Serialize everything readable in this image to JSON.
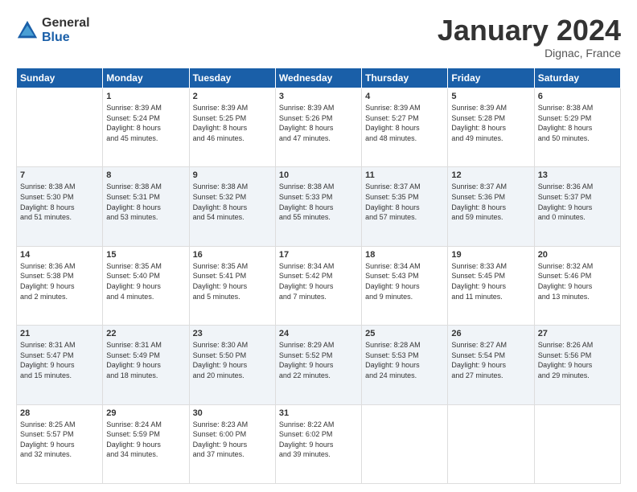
{
  "logo": {
    "general": "General",
    "blue": "Blue"
  },
  "title": "January 2024",
  "location": "Dignac, France",
  "days_header": [
    "Sunday",
    "Monday",
    "Tuesday",
    "Wednesday",
    "Thursday",
    "Friday",
    "Saturday"
  ],
  "weeks": [
    [
      {
        "num": "",
        "text": ""
      },
      {
        "num": "1",
        "text": "Sunrise: 8:39 AM\nSunset: 5:24 PM\nDaylight: 8 hours\nand 45 minutes."
      },
      {
        "num": "2",
        "text": "Sunrise: 8:39 AM\nSunset: 5:25 PM\nDaylight: 8 hours\nand 46 minutes."
      },
      {
        "num": "3",
        "text": "Sunrise: 8:39 AM\nSunset: 5:26 PM\nDaylight: 8 hours\nand 47 minutes."
      },
      {
        "num": "4",
        "text": "Sunrise: 8:39 AM\nSunset: 5:27 PM\nDaylight: 8 hours\nand 48 minutes."
      },
      {
        "num": "5",
        "text": "Sunrise: 8:39 AM\nSunset: 5:28 PM\nDaylight: 8 hours\nand 49 minutes."
      },
      {
        "num": "6",
        "text": "Sunrise: 8:38 AM\nSunset: 5:29 PM\nDaylight: 8 hours\nand 50 minutes."
      }
    ],
    [
      {
        "num": "7",
        "text": "Sunrise: 8:38 AM\nSunset: 5:30 PM\nDaylight: 8 hours\nand 51 minutes."
      },
      {
        "num": "8",
        "text": "Sunrise: 8:38 AM\nSunset: 5:31 PM\nDaylight: 8 hours\nand 53 minutes."
      },
      {
        "num": "9",
        "text": "Sunrise: 8:38 AM\nSunset: 5:32 PM\nDaylight: 8 hours\nand 54 minutes."
      },
      {
        "num": "10",
        "text": "Sunrise: 8:38 AM\nSunset: 5:33 PM\nDaylight: 8 hours\nand 55 minutes."
      },
      {
        "num": "11",
        "text": "Sunrise: 8:37 AM\nSunset: 5:35 PM\nDaylight: 8 hours\nand 57 minutes."
      },
      {
        "num": "12",
        "text": "Sunrise: 8:37 AM\nSunset: 5:36 PM\nDaylight: 8 hours\nand 59 minutes."
      },
      {
        "num": "13",
        "text": "Sunrise: 8:36 AM\nSunset: 5:37 PM\nDaylight: 9 hours\nand 0 minutes."
      }
    ],
    [
      {
        "num": "14",
        "text": "Sunrise: 8:36 AM\nSunset: 5:38 PM\nDaylight: 9 hours\nand 2 minutes."
      },
      {
        "num": "15",
        "text": "Sunrise: 8:35 AM\nSunset: 5:40 PM\nDaylight: 9 hours\nand 4 minutes."
      },
      {
        "num": "16",
        "text": "Sunrise: 8:35 AM\nSunset: 5:41 PM\nDaylight: 9 hours\nand 5 minutes."
      },
      {
        "num": "17",
        "text": "Sunrise: 8:34 AM\nSunset: 5:42 PM\nDaylight: 9 hours\nand 7 minutes."
      },
      {
        "num": "18",
        "text": "Sunrise: 8:34 AM\nSunset: 5:43 PM\nDaylight: 9 hours\nand 9 minutes."
      },
      {
        "num": "19",
        "text": "Sunrise: 8:33 AM\nSunset: 5:45 PM\nDaylight: 9 hours\nand 11 minutes."
      },
      {
        "num": "20",
        "text": "Sunrise: 8:32 AM\nSunset: 5:46 PM\nDaylight: 9 hours\nand 13 minutes."
      }
    ],
    [
      {
        "num": "21",
        "text": "Sunrise: 8:31 AM\nSunset: 5:47 PM\nDaylight: 9 hours\nand 15 minutes."
      },
      {
        "num": "22",
        "text": "Sunrise: 8:31 AM\nSunset: 5:49 PM\nDaylight: 9 hours\nand 18 minutes."
      },
      {
        "num": "23",
        "text": "Sunrise: 8:30 AM\nSunset: 5:50 PM\nDaylight: 9 hours\nand 20 minutes."
      },
      {
        "num": "24",
        "text": "Sunrise: 8:29 AM\nSunset: 5:52 PM\nDaylight: 9 hours\nand 22 minutes."
      },
      {
        "num": "25",
        "text": "Sunrise: 8:28 AM\nSunset: 5:53 PM\nDaylight: 9 hours\nand 24 minutes."
      },
      {
        "num": "26",
        "text": "Sunrise: 8:27 AM\nSunset: 5:54 PM\nDaylight: 9 hours\nand 27 minutes."
      },
      {
        "num": "27",
        "text": "Sunrise: 8:26 AM\nSunset: 5:56 PM\nDaylight: 9 hours\nand 29 minutes."
      }
    ],
    [
      {
        "num": "28",
        "text": "Sunrise: 8:25 AM\nSunset: 5:57 PM\nDaylight: 9 hours\nand 32 minutes."
      },
      {
        "num": "29",
        "text": "Sunrise: 8:24 AM\nSunset: 5:59 PM\nDaylight: 9 hours\nand 34 minutes."
      },
      {
        "num": "30",
        "text": "Sunrise: 8:23 AM\nSunset: 6:00 PM\nDaylight: 9 hours\nand 37 minutes."
      },
      {
        "num": "31",
        "text": "Sunrise: 8:22 AM\nSunset: 6:02 PM\nDaylight: 9 hours\nand 39 minutes."
      },
      {
        "num": "",
        "text": ""
      },
      {
        "num": "",
        "text": ""
      },
      {
        "num": "",
        "text": ""
      }
    ]
  ]
}
